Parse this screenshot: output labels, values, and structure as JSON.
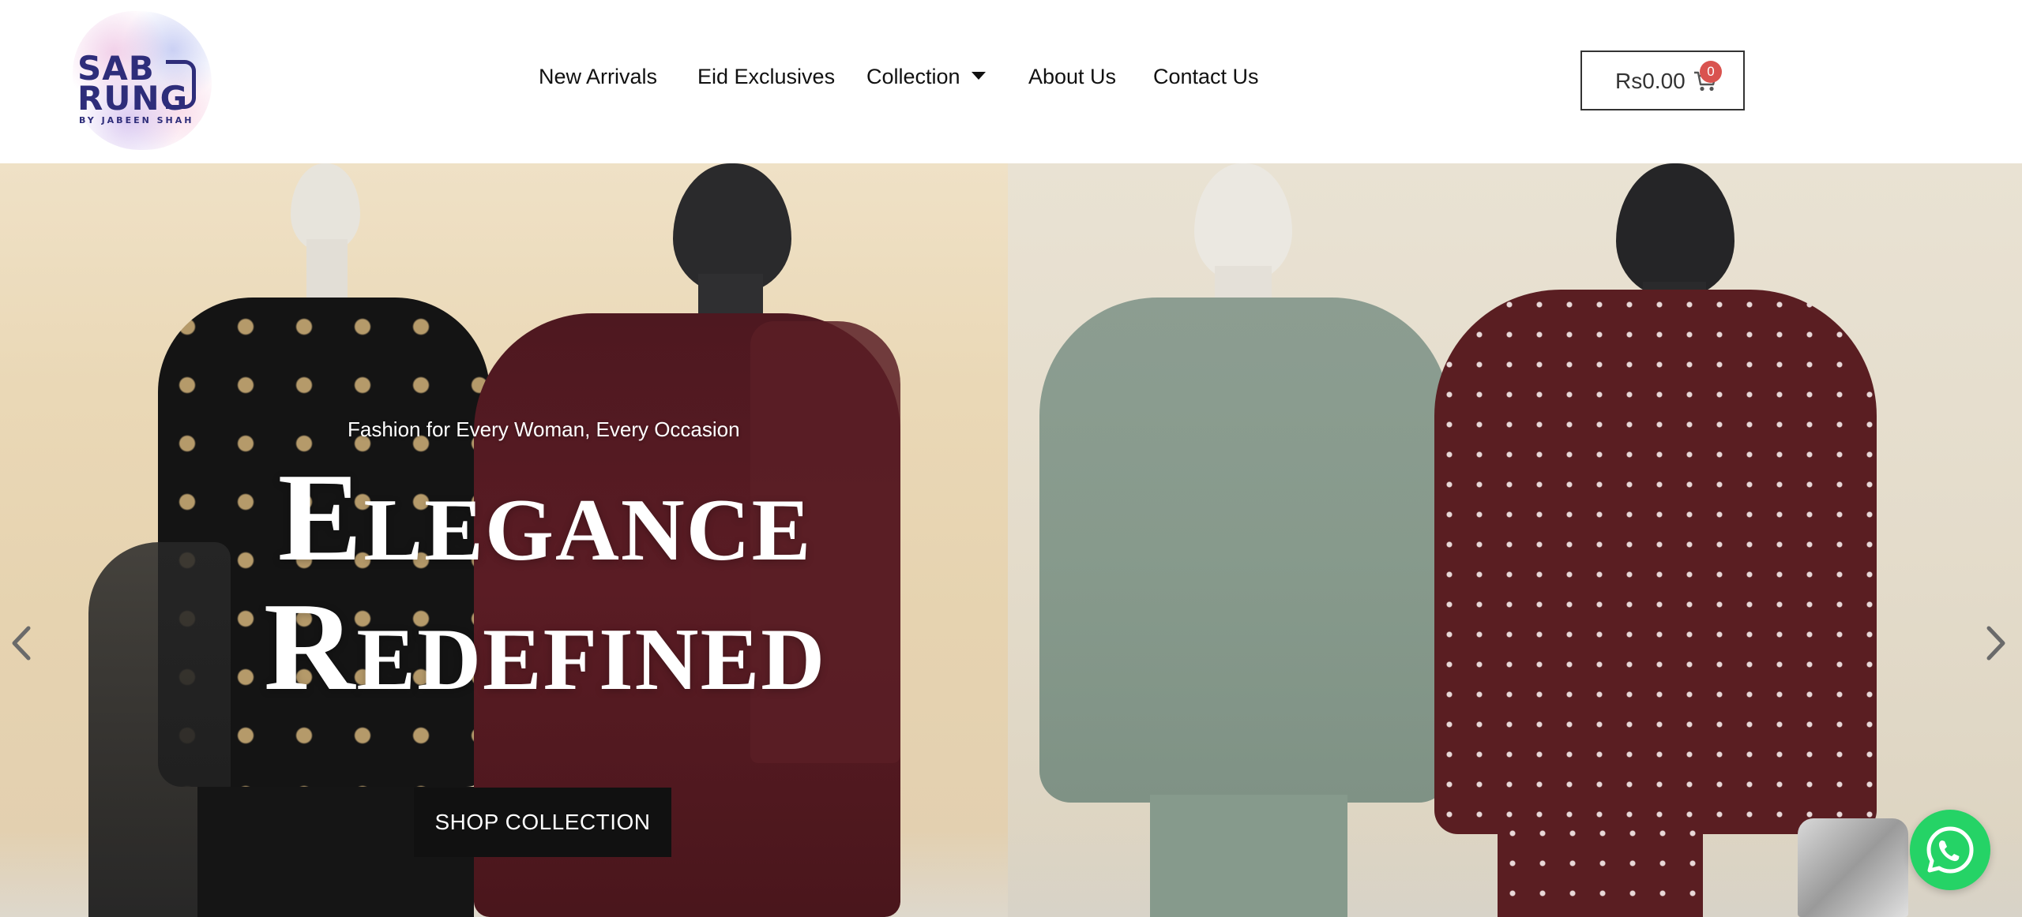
{
  "brand": {
    "logo_line1": "SAB",
    "logo_line2": "RUNG",
    "logo_tagline": "BY JABEEN SHAH"
  },
  "nav": {
    "items": [
      {
        "label": "New Arrivals"
      },
      {
        "label": "Eid Exclusives"
      },
      {
        "label": "Collection",
        "has_dropdown": true
      },
      {
        "label": "About Us"
      },
      {
        "label": "Contact Us"
      }
    ]
  },
  "cart": {
    "total": "Rs0.00",
    "count": "0",
    "badge_color": "#d9534f"
  },
  "hero": {
    "subtitle": "Fashion for Every Woman, Every Occasion",
    "title_line1": "Elegance",
    "title_line2": "Redefined",
    "cta_label": "SHOP COLLECTION"
  },
  "icons": {
    "cart": "cart-icon",
    "prev": "chevron-left-icon",
    "next": "chevron-right-icon",
    "whatsapp": "whatsapp-icon",
    "dropdown": "caret-down-icon"
  },
  "colors": {
    "whatsapp": "#25d366",
    "button": "#111111",
    "logo": "#2e2d7a"
  }
}
